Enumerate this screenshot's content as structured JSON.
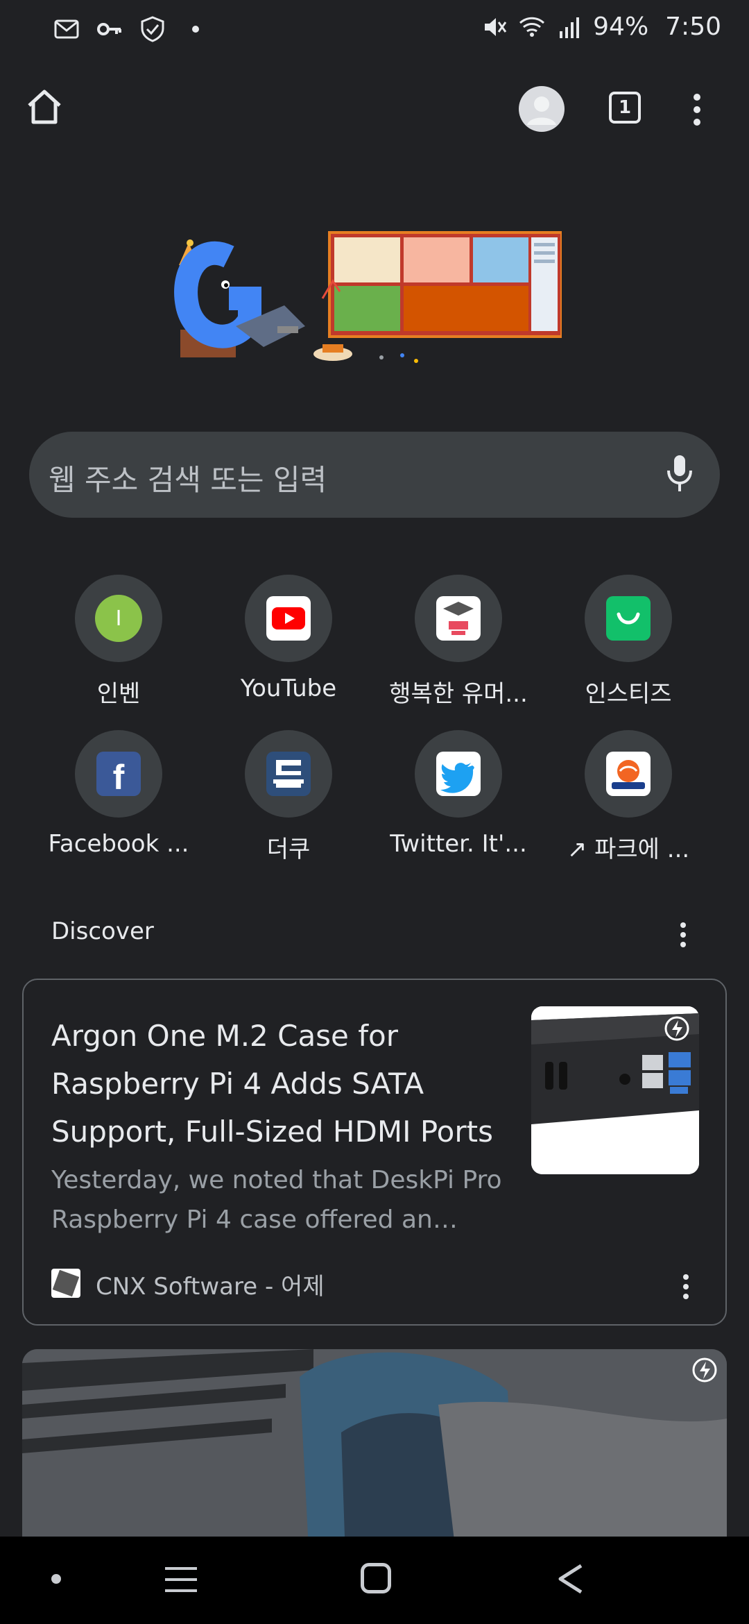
{
  "status_bar": {
    "battery": "94%",
    "time": "7:50",
    "icons": [
      "mail-icon",
      "key-icon",
      "shield-icon",
      "dot-icon",
      "mute-icon",
      "wifi-icon",
      "signal-icon"
    ]
  },
  "toolbar": {
    "tab_count": "1",
    "icons": [
      "home-icon",
      "avatar-icon",
      "tab-switcher-icon",
      "more-vert-icon"
    ]
  },
  "search": {
    "placeholder": "웹 주소 검색 또는 입력",
    "mic_icon": "mic-icon"
  },
  "shortcuts": [
    {
      "label": "인벤",
      "icon": "inven-icon",
      "color": "#8bc34a"
    },
    {
      "label": "YouTube",
      "icon": "youtube-icon",
      "color": "#ff0000"
    },
    {
      "label": "행복한 유머...",
      "icon": "humor-univ-icon",
      "color": "#ffffff"
    },
    {
      "label": "인스티즈",
      "icon": "instiz-icon",
      "color": "#12c06a"
    },
    {
      "label": "Facebook ...",
      "icon": "facebook-icon",
      "color": "#3b5998"
    },
    {
      "label": "더쿠",
      "icon": "theqoo-icon",
      "color": "#2e4e7a"
    },
    {
      "label": "Twitter. It'...",
      "icon": "twitter-icon",
      "color": "#1da1f2"
    },
    {
      "label": "↗ 파크에 ...",
      "icon": "mlbpark-icon",
      "color": "#f26522"
    }
  ],
  "discover": {
    "heading": "Discover",
    "cards": [
      {
        "title": "Argon One M.2 Case for Raspberry Pi 4 Adds SATA Support, Full-Sized HDMI Ports",
        "snippet": "Yesterday, we noted that DeskPi Pro Raspberry Pi 4 case offered an…",
        "source": "CNX Software - 어제",
        "badge_icon": "amp-lightning-icon"
      }
    ]
  },
  "nav_bar": {
    "icons": [
      "dot-icon",
      "recents-icon",
      "home-icon",
      "back-icon"
    ]
  }
}
